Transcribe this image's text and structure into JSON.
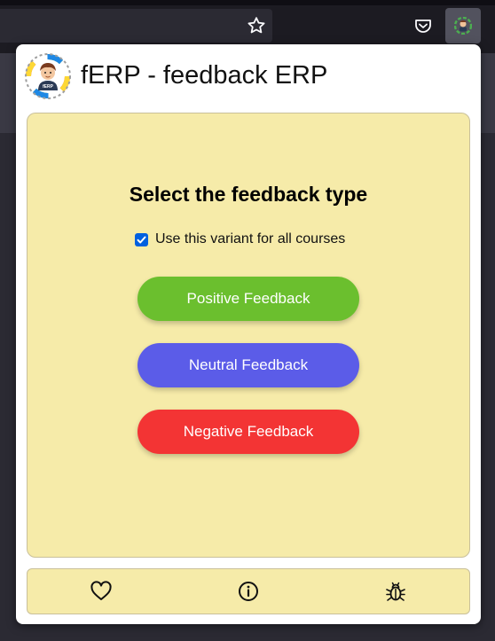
{
  "browser": {
    "icons": [
      "star-icon",
      "pocket-icon",
      "ferp-extension-icon"
    ]
  },
  "popup": {
    "title": "fERP - feedback ERP",
    "logo_text": "fERP",
    "heading": "Select the feedback type",
    "checkbox": {
      "label": "Use this variant for all courses",
      "checked": true
    },
    "buttons": {
      "positive": "Positive Feedback",
      "neutral": "Neutral Feedback",
      "negative": "Negative Feedback"
    },
    "colors": {
      "card": "#f6eba9",
      "positive": "#6bbf2e",
      "neutral": "#5b5ce8",
      "negative": "#f33434"
    },
    "footer_icons": [
      "heart-icon",
      "info-icon",
      "bug-icon"
    ]
  }
}
